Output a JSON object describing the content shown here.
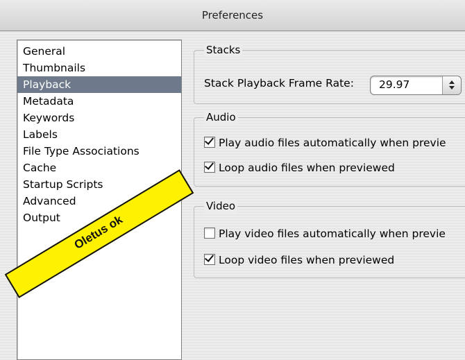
{
  "window": {
    "title": "Preferences"
  },
  "sidebar": {
    "items": [
      {
        "label": "General",
        "selected": false
      },
      {
        "label": "Thumbnails",
        "selected": false
      },
      {
        "label": "Playback",
        "selected": true
      },
      {
        "label": "Metadata",
        "selected": false
      },
      {
        "label": "Keywords",
        "selected": false
      },
      {
        "label": "Labels",
        "selected": false
      },
      {
        "label": "File Type Associations",
        "selected": false
      },
      {
        "label": "Cache",
        "selected": false
      },
      {
        "label": "Startup Scripts",
        "selected": false
      },
      {
        "label": "Advanced",
        "selected": false
      },
      {
        "label": "Output",
        "selected": false
      }
    ]
  },
  "stacks": {
    "label": "Stacks",
    "framerate_label": "Stack Playback Frame Rate:",
    "framerate_value": "29.97"
  },
  "audio": {
    "label": "Audio",
    "play_auto": {
      "label": "Play audio files automatically when previe",
      "checked": true
    },
    "loop": {
      "label": "Loop audio files when previewed",
      "checked": true
    }
  },
  "video": {
    "label": "Video",
    "play_auto": {
      "label": "Play video files automatically when previe",
      "checked": false
    },
    "loop": {
      "label": "Loop video files when previewed",
      "checked": true
    }
  },
  "annotation": {
    "text": "Oletus ok",
    "color": "#fff200"
  },
  "colors": {
    "selection": "#6e7a8c"
  }
}
